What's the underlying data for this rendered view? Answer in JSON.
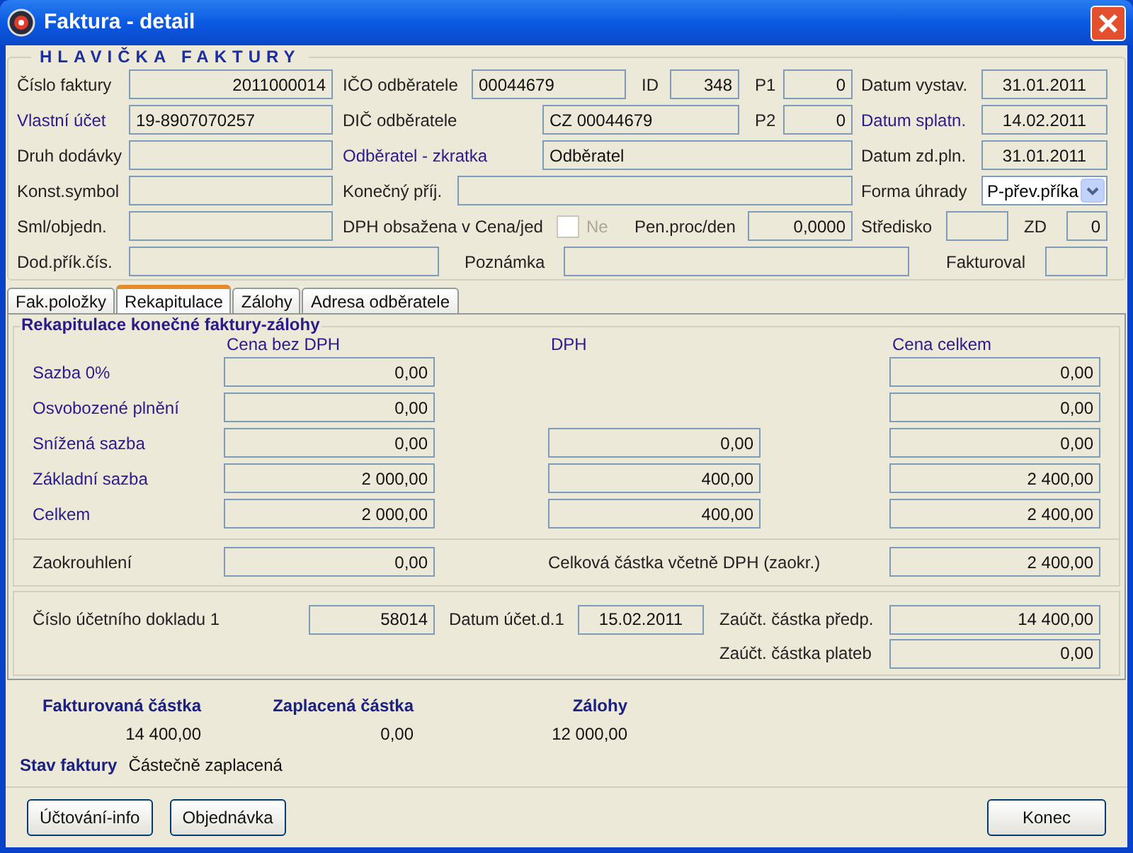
{
  "window": {
    "title": "Faktura - detail"
  },
  "header": {
    "title": "HLAVIČKA FAKTURY",
    "fields": [
      {
        "label": "Číslo faktury",
        "link": false,
        "kind": "field",
        "value": "2011000014"
      },
      {
        "label": "IČO odběratele",
        "link": false,
        "kind": "field",
        "value": "00044679"
      },
      {
        "label": "ID",
        "link": false,
        "kind": "field",
        "value": "348"
      },
      {
        "label": "P1",
        "link": false,
        "kind": "field",
        "value": "0"
      },
      {
        "label": "Datum vystav.",
        "link": false,
        "kind": "field",
        "value": "31.01.2011"
      },
      {
        "label": "Vlastní účet",
        "link": true,
        "kind": "field",
        "value": "19-8907070257"
      },
      {
        "label": "DIČ odběratele",
        "link": false,
        "kind": "field",
        "value": "CZ 00044679"
      },
      {
        "label": "P2",
        "link": false,
        "kind": "field",
        "value": "0"
      },
      {
        "label": "Datum splatn.",
        "link": true,
        "kind": "field",
        "value": "14.02.2011"
      },
      {
        "label": "Druh dodávky",
        "link": false,
        "kind": "field"
      },
      {
        "label": "Odběratel - zkratka",
        "link": true,
        "kind": "field",
        "value": "Odběratel"
      },
      {
        "label": "Datum zd.pln.",
        "link": false,
        "kind": "field",
        "value": "31.01.2011"
      },
      {
        "label": "Konst.symbol",
        "link": false,
        "kind": "field"
      },
      {
        "label": "Konečný příj.",
        "link": false,
        "kind": "field"
      },
      {
        "label": "Forma úhrady",
        "link": false,
        "kind": "select",
        "value": "P-přev.příka"
      },
      {
        "label": "Sml/objedn.",
        "link": false,
        "kind": "field"
      },
      {
        "label": "DPH obsažena v Cena/jed",
        "link": false,
        "kind": "checkbox",
        "option": "Ne",
        "checked": false,
        "disabled": true
      },
      {
        "label": "Pen.proc/den",
        "link": false,
        "kind": "field",
        "value": "0,0000"
      },
      {
        "label": "Středisko",
        "link": false,
        "kind": "field"
      },
      {
        "label": "ZD",
        "link": false,
        "kind": "field",
        "value": "0"
      },
      {
        "label": "Dod.přík.čís.",
        "link": false,
        "kind": "field"
      },
      {
        "label": "Poznámka",
        "link": false,
        "kind": "field"
      },
      {
        "label": "Fakturoval",
        "link": false,
        "kind": "field"
      }
    ]
  },
  "tabs": [
    {
      "label": "Fak.položky",
      "selected": false
    },
    {
      "label": "Rekapitulace",
      "selected": true
    },
    {
      "label": "Zálohy",
      "selected": false
    },
    {
      "label": "Adresa odběratele",
      "selected": false
    }
  ],
  "recap": {
    "title": "Rekapitulace konečné faktury-zálohy",
    "columns": [
      "Cena bez DPH",
      "DPH",
      "Cena celkem"
    ],
    "rows": [
      {
        "label": "Sazba 0%",
        "without_vat": "0,00",
        "total": "0,00"
      },
      {
        "label": "Osvobozené plnění",
        "without_vat": "0,00",
        "total": "0,00"
      },
      {
        "label": "Snížená sazba",
        "without_vat": "0,00",
        "vat": "0,00",
        "total": "0,00"
      },
      {
        "label": "Základní sazba",
        "without_vat": "2 000,00",
        "vat": "400,00",
        "total": "2 400,00"
      },
      {
        "label": "Celkem",
        "without_vat": "2 000,00",
        "vat": "400,00",
        "total": "2 400,00"
      }
    ],
    "rounding": {
      "label": "Zaokrouhlení",
      "value": "0,00",
      "total_label": "Celková částka včetně DPH (zaokr.)",
      "total_value": "2 400,00"
    }
  },
  "accounting": {
    "doc_label": "Číslo účetního dokladu 1",
    "doc_value": "58014",
    "date_label": "Datum účet.d.1",
    "date_value": "15.02.2011",
    "rows": [
      {
        "label": "Zaúčt. částka předp.",
        "value": "14 400,00"
      },
      {
        "label": "Zaúčt. částka plateb",
        "value": "0,00"
      }
    ]
  },
  "summary": {
    "columns": [
      {
        "label": "Fakturovaná částka",
        "value": "14 400,00"
      },
      {
        "label": "Zaplacená částka",
        "value": "0,00"
      },
      {
        "label": "Zálohy",
        "value": "12 000,00"
      }
    ],
    "status_label": "Stav faktury",
    "status_value": "Částečně zaplacená"
  },
  "buttons": {
    "left": [
      "Účtování-info",
      "Objednávka"
    ],
    "right": [
      "Konec"
    ]
  }
}
